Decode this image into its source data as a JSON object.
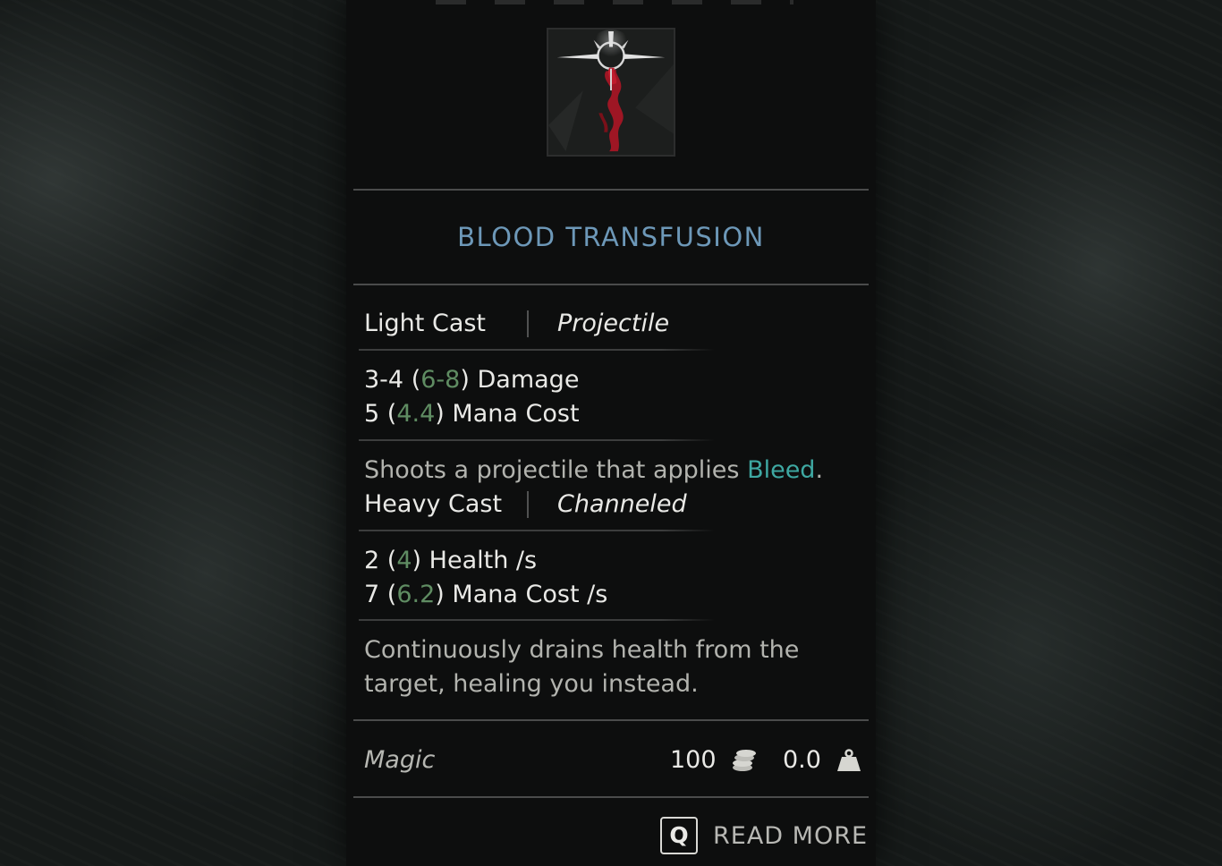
{
  "tooltip": {
    "item_icon": "blood-transfusion-spell-icon",
    "title": "BLOOD TRANSFUSION",
    "light_cast": {
      "label": "Light Cast",
      "type": "Projectile",
      "damage_base": "3-4",
      "damage_open": "(",
      "damage_upgraded": "6-8",
      "damage_close": ")",
      "damage_label": "Damage",
      "mana_base": "5",
      "mana_open": "(",
      "mana_upgraded": "4.4",
      "mana_close": ")",
      "mana_label": "Mana Cost",
      "description_prefix": "Shoots a projectile that applies ",
      "description_keyword": "Bleed",
      "description_suffix": "."
    },
    "heavy_cast": {
      "label": "Heavy Cast",
      "type": "Channeled",
      "health_base": "2",
      "health_open": "(",
      "health_upgraded": "4",
      "health_close": ")",
      "health_label": "Health /s",
      "mana_base": "7",
      "mana_open": "(",
      "mana_upgraded": "6.2",
      "mana_close": ")",
      "mana_label": "Mana Cost /s",
      "description_line1": "Continuously drains health from the",
      "description_line2": "target, healing you instead."
    },
    "footer": {
      "category": "Magic",
      "value": "100",
      "value_icon": "coins-icon",
      "weight": "0.0",
      "weight_icon": "weight-icon"
    },
    "read_more": {
      "key": "Q",
      "label": "READ MORE"
    }
  },
  "colors": {
    "title": "#6d98b8",
    "upgraded_value": "#5f8c62",
    "keyword": "#3ea8a2",
    "panel_bg": "#0d0e0e"
  }
}
